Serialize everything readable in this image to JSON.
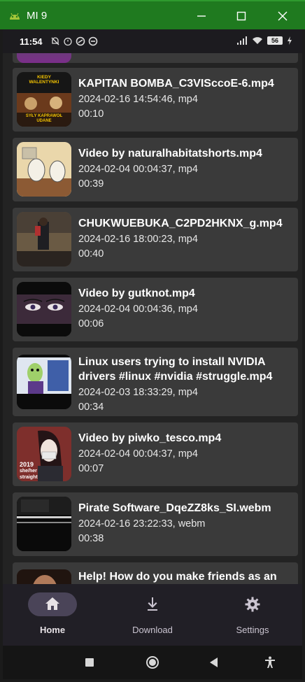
{
  "window": {
    "title": "MI 9"
  },
  "status": {
    "time": "11:54",
    "battery": "56"
  },
  "videos": [
    {
      "title": "KAPITAN BOMBA_C3VISccoE-6.mp4",
      "meta": "2024-02-16 14:54:46, mp4",
      "duration": "00:10",
      "thumb_text": [
        "KIEDY",
        "WALENTYNKI",
        "SYŁY KAPRAWOŁ",
        "UDANE"
      ]
    },
    {
      "title": "Video by naturalhabitatshorts.mp4",
      "meta": "2024-02-04 00:04:37, mp4",
      "duration": "00:39"
    },
    {
      "title": "CHUKWUEBUKA_C2PD2HKNX_g.mp4",
      "meta": "2024-02-16 18:00:23, mp4",
      "duration": "00:40"
    },
    {
      "title": "Video by gutknot.mp4",
      "meta": "2024-02-04 00:04:36, mp4",
      "duration": "00:06"
    },
    {
      "title": "Linux users trying to install NVIDIA drivers #linux #nvidia #struggle.mp4",
      "meta": "2024-02-03 18:33:29, mp4",
      "duration": "00:34"
    },
    {
      "title": "Video by piwko_tesco.mp4",
      "meta": "2024-02-04 00:04:37, mp4",
      "duration": "00:07",
      "thumb_text": [
        "2019",
        "she/her",
        "straight"
      ]
    },
    {
      "title": "Pirate Software_DqeZZ8ks_SI.webm",
      "meta": "2024-02-16 23:22:33, webm",
      "duration": "00:38"
    },
    {
      "title": "Help! How do you make friends as an"
    }
  ],
  "nav": {
    "home": "Home",
    "download": "Download",
    "settings": "Settings"
  },
  "colors": {
    "titlebar": "#1f7a1f",
    "card": "#3a3a3a",
    "nav_pill": "#4a4458"
  }
}
